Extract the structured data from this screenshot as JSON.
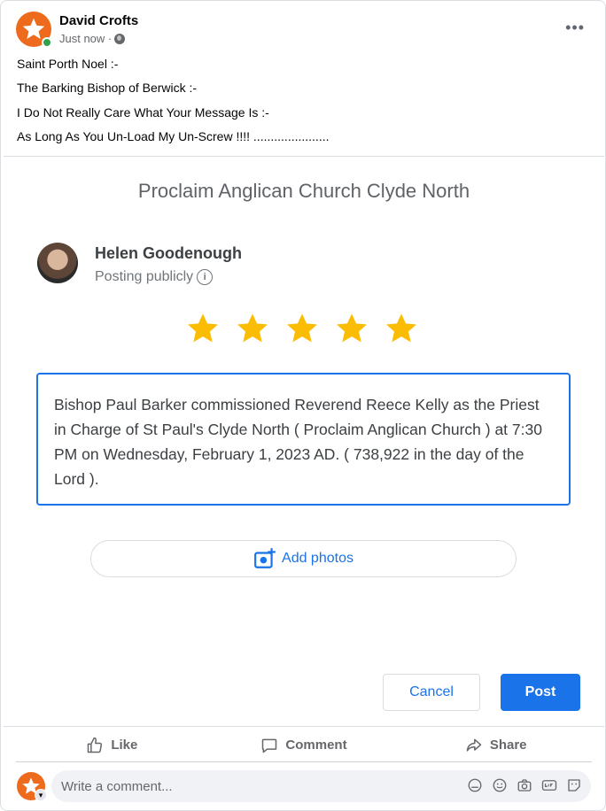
{
  "post": {
    "author": "David Crofts",
    "time": "Just now ·",
    "visibility_icon": "globe-icon",
    "more_icon": "•••",
    "lines": [
      "Saint Porth Noel :-",
      "The Barking Bishop of Berwick :-",
      "I Do Not Really Care What Your Message Is :-",
      "As Long As You Un-Load My Un-Screw !!!! ......................"
    ]
  },
  "review": {
    "title": "Proclaim Anglican Church Clyde North",
    "reviewer_name": "Helen Goodenough",
    "posting_label": "Posting publicly",
    "rating": 5,
    "rating_max": 5,
    "text": "Bishop Paul Barker commissioned Reverend Reece Kelly as the Priest in Charge of St Paul's Clyde North ( Proclaim Anglican Church ) at 7:30 PM on Wednesday, February 1, 2023 AD. ( 738,922 in the day of the Lord ).",
    "add_photos": "Add photos",
    "cancel": "Cancel",
    "post": "Post"
  },
  "actions": {
    "like": "Like",
    "comment": "Comment",
    "share": "Share"
  },
  "comment": {
    "placeholder": "Write a comment..."
  },
  "colors": {
    "accent_blue": "#1a73e8",
    "star_yellow": "#fbbc04",
    "avatar_orange": "#ee6b1e",
    "online_green": "#31a24c"
  }
}
